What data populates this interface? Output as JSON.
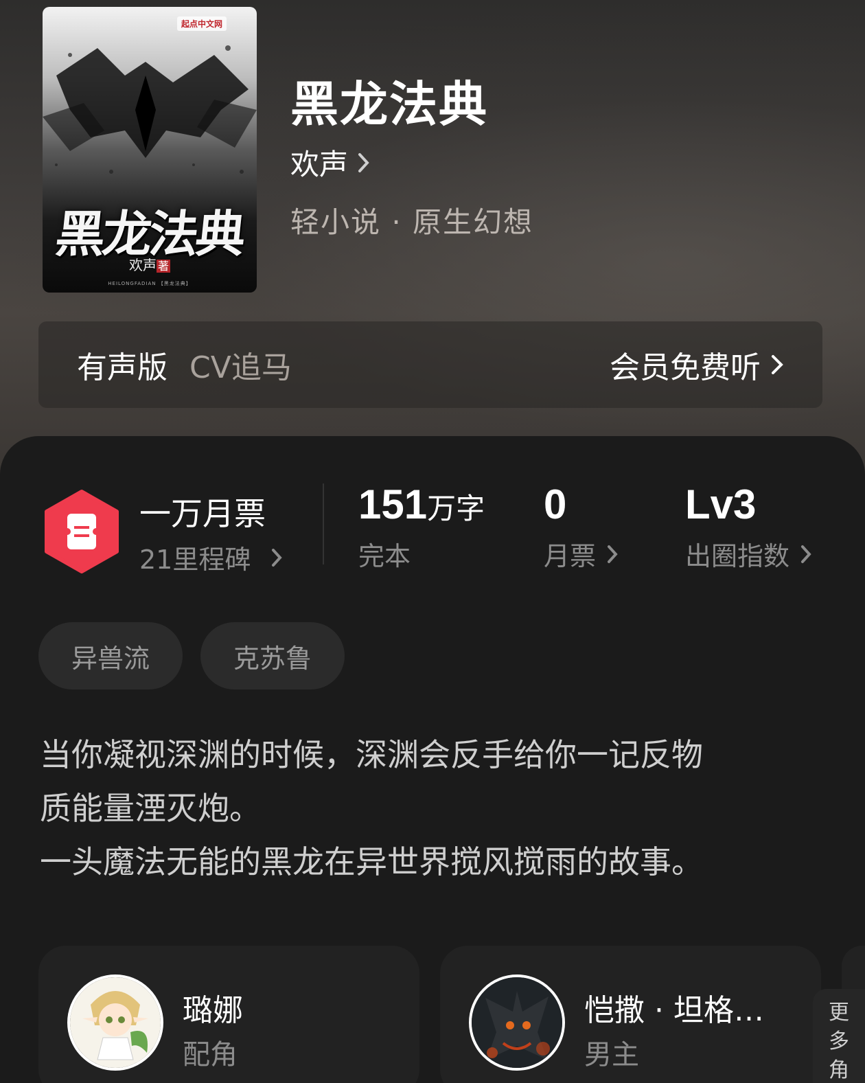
{
  "book": {
    "title": "黑龙法典",
    "author": "欢声",
    "genre": "轻小说 · 原生幻想",
    "cover": {
      "publisher_logo": "起点中文网",
      "title": "黑龙法典",
      "author": "欢声",
      "seal": "著",
      "subtitle": "HEILONGFADIAN 【黑龙法典】"
    }
  },
  "audio": {
    "label": "有声版",
    "cv": "CV追马",
    "action": "会员免费听"
  },
  "badge": {
    "title": "一万月票",
    "subtitle": "21里程碑"
  },
  "stats": [
    {
      "value": "151",
      "unit": "万字",
      "label": "完本"
    },
    {
      "value": "0",
      "unit": "",
      "label": "月票"
    },
    {
      "value": "Lv3",
      "unit": "",
      "label": "出圈指数"
    }
  ],
  "tags": [
    "异兽流",
    "克苏鲁"
  ],
  "description": [
    "当你凝视深渊的时候，深渊会反手给你一记反物",
    "质能量湮灭炮。",
    "一头魔法无能的黑龙在异世界搅风搅雨的故事。"
  ],
  "characters": [
    {
      "name": "璐娜",
      "role": "配角"
    },
    {
      "name": "恺撒 · 坦格…",
      "role": "男主"
    }
  ],
  "more_tab": [
    "更",
    "多",
    "角"
  ],
  "colors": {
    "accent_red": "#ef3b4d",
    "background": "#1b1b1b",
    "muted_text": "#8c8c8c"
  }
}
